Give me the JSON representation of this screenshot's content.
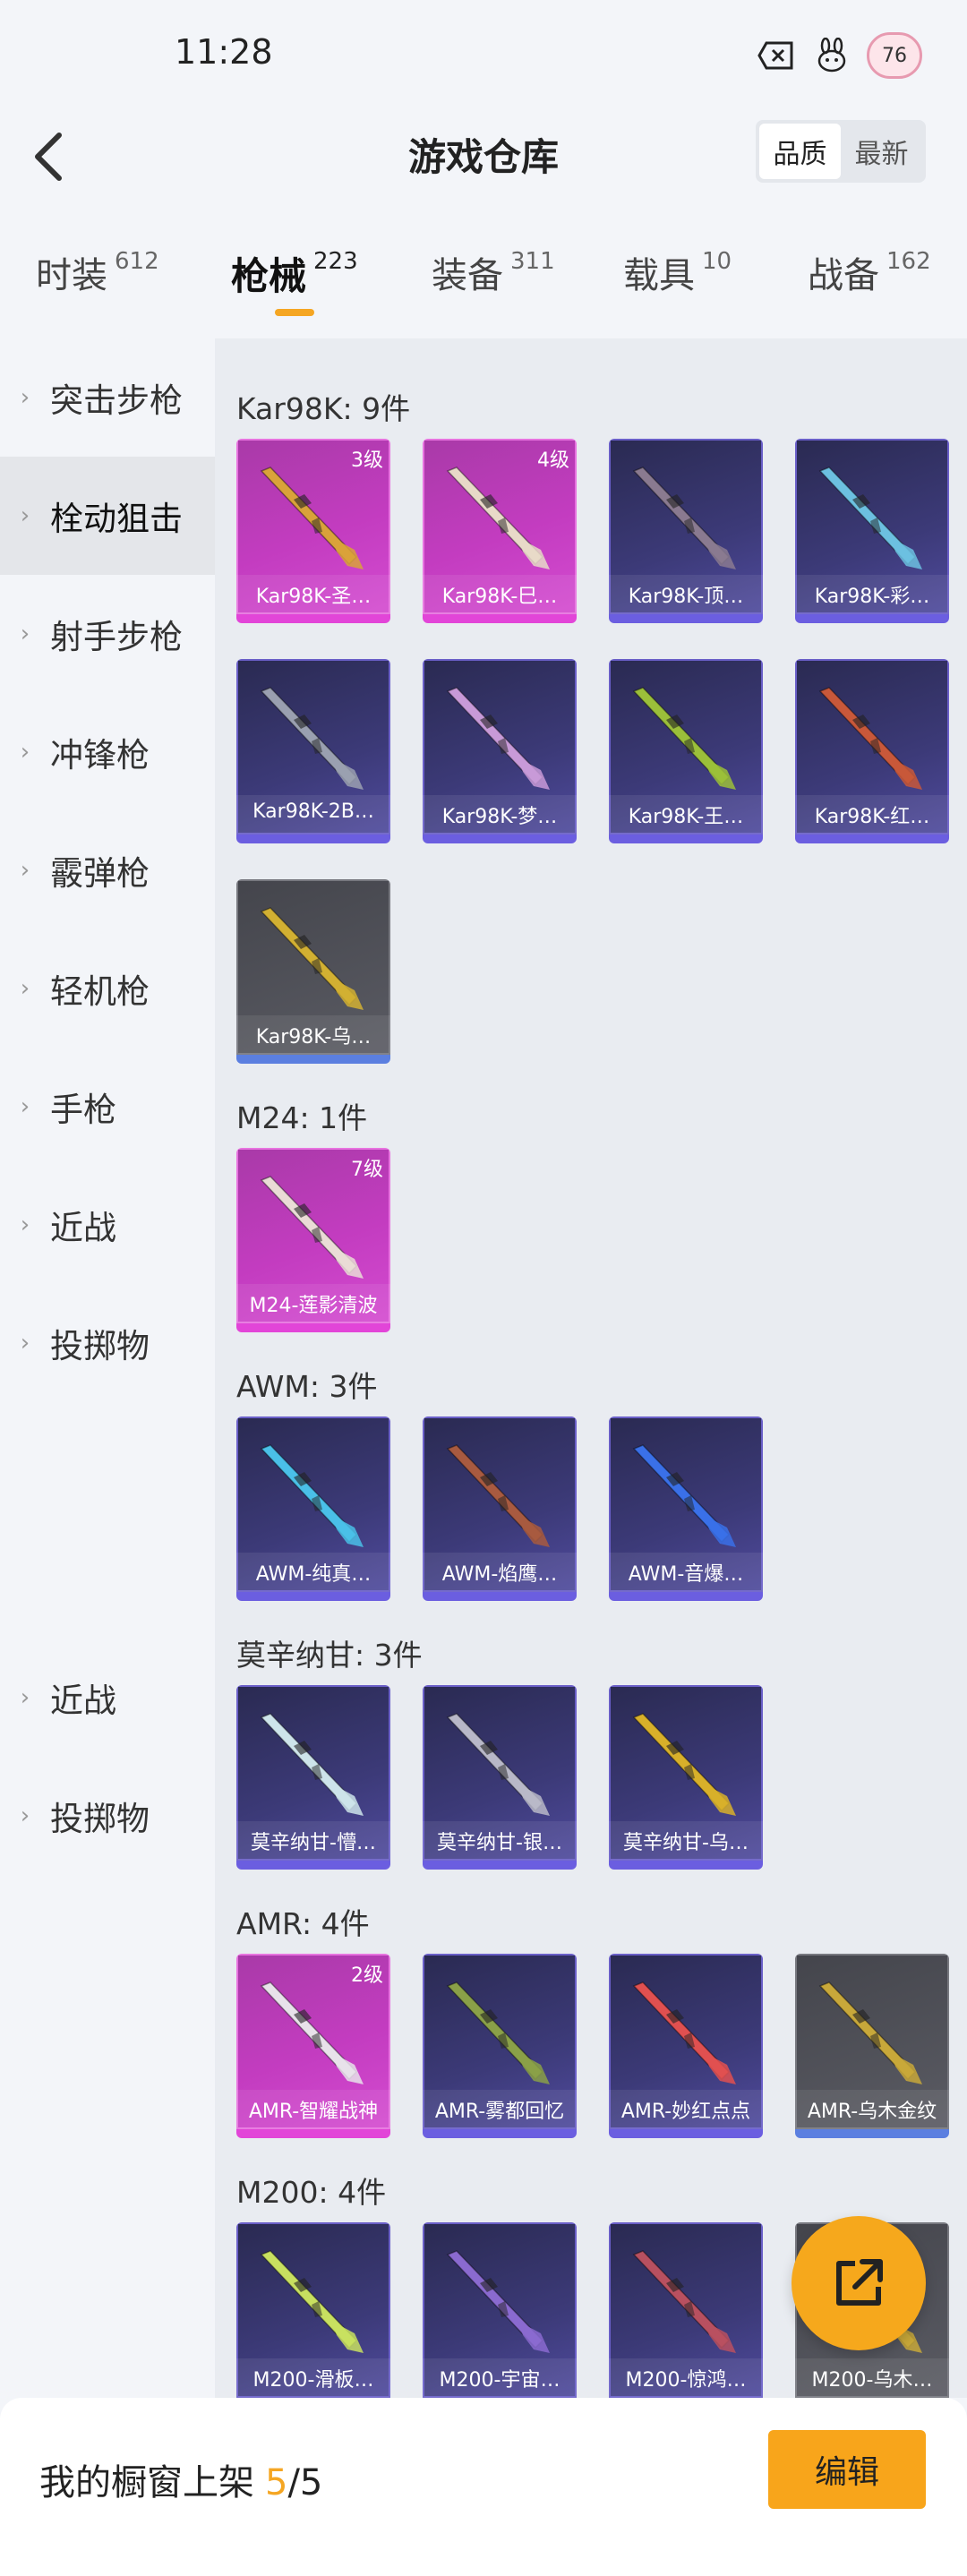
{
  "status_bar": {
    "time": "11:28",
    "level": "76"
  },
  "header": {
    "title": "游戏仓库",
    "sort_options": [
      "品质",
      "最新"
    ],
    "active_sort": "品质"
  },
  "tabs": [
    {
      "label": "时装",
      "count": "612"
    },
    {
      "label": "枪械",
      "count": "223"
    },
    {
      "label": "装备",
      "count": "311"
    },
    {
      "label": "载具",
      "count": "10"
    },
    {
      "label": "战备",
      "count": "162"
    }
  ],
  "sidebar": {
    "items": [
      "突击步枪",
      "栓动狙击",
      "射手步枪",
      "冲锋枪",
      "霰弹枪",
      "轻机枪",
      "手枪",
      "近战",
      "投掷物"
    ],
    "extra_items": [
      "近战",
      "投掷物"
    ]
  },
  "groups": [
    {
      "title": "Kar98K: 9件",
      "cards": [
        {
          "name": "Kar98K-圣…",
          "level": "3级",
          "style": "pink",
          "color": "#d9a23a"
        },
        {
          "name": "Kar98K-巳…",
          "level": "4级",
          "style": "pink",
          "color": "#e8d9c8"
        },
        {
          "name": "Kar98K-顶…",
          "level": "",
          "style": "blue",
          "color": "#8a7a90"
        },
        {
          "name": "Kar98K-彩…",
          "level": "",
          "style": "blue",
          "color": "#6cc0e0"
        },
        {
          "name": "Kar98K-2B…",
          "level": "",
          "style": "blue",
          "color": "#9aa0b0"
        },
        {
          "name": "Kar98K-梦…",
          "level": "",
          "style": "blue",
          "color": "#c89ad8"
        },
        {
          "name": "Kar98K-王…",
          "level": "",
          "style": "blue",
          "color": "#9bbf3a"
        },
        {
          "name": "Kar98K-红…",
          "level": "",
          "style": "blue",
          "color": "#c8583a"
        },
        {
          "name": "Kar98K-乌…",
          "level": "",
          "style": "gray",
          "color": "#d2b032"
        }
      ]
    },
    {
      "title": "M24: 1件",
      "cards": [
        {
          "name": "M24-莲影清波",
          "level": "7级",
          "style": "pink",
          "color": "#eadcd6"
        }
      ]
    },
    {
      "title": "AWM: 3件",
      "cards": [
        {
          "name": "AWM-纯真…",
          "level": "",
          "style": "blue",
          "color": "#4ac0e8"
        },
        {
          "name": "AWM-焰鹰…",
          "level": "",
          "style": "blue",
          "color": "#a85a40"
        },
        {
          "name": "AWM-音爆…",
          "level": "",
          "style": "blue",
          "color": "#3a70e8"
        }
      ]
    },
    {
      "title": "莫辛纳甘: 3件",
      "cards": [
        {
          "name": "莫辛纳甘-懵…",
          "level": "",
          "style": "blue",
          "color": "#cde4ea"
        },
        {
          "name": "莫辛纳甘-银…",
          "level": "",
          "style": "blue",
          "color": "#b8b8c8"
        },
        {
          "name": "莫辛纳甘-乌…",
          "level": "",
          "style": "blue",
          "color": "#d8b02a"
        }
      ]
    },
    {
      "title": "AMR: 4件",
      "cards": [
        {
          "name": "AMR-智耀战神",
          "level": "2级",
          "style": "pink",
          "color": "#e8e2ea"
        },
        {
          "name": "AMR-雾都回忆",
          "level": "",
          "style": "blue",
          "color": "#8aa048"
        },
        {
          "name": "AMR-妙红点点",
          "level": "",
          "style": "blue",
          "color": "#e05050"
        },
        {
          "name": "AMR-乌木金纹",
          "level": "",
          "style": "gray",
          "color": "#c8a83a"
        }
      ]
    },
    {
      "title": "M200: 4件",
      "cards": [
        {
          "name": "M200-滑板…",
          "level": "",
          "style": "blue",
          "color": "#c8e060"
        },
        {
          "name": "M200-宇宙…",
          "level": "",
          "style": "blue",
          "color": "#8a6ad0"
        },
        {
          "name": "M200-惊鸿…",
          "level": "",
          "style": "blue",
          "color": "#b85060"
        },
        {
          "name": "M200-乌木…",
          "level": "",
          "style": "gray",
          "color": "#c8a83a"
        }
      ]
    }
  ],
  "bottom_bar": {
    "label": "我的橱窗上架",
    "current": "5",
    "total": "/5",
    "edit_label": "编辑"
  }
}
